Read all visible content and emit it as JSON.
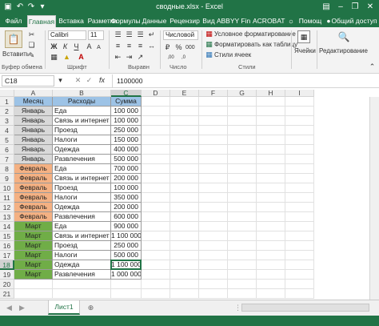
{
  "titlebar": {
    "title": "сводные.xlsx - Excel",
    "qa_icons": [
      "save-icon",
      "undo-icon",
      "redo-icon",
      "customize-icon"
    ],
    "window_controls": [
      "ribbon-display-icon",
      "minimize-icon",
      "restore-icon",
      "close-icon"
    ]
  },
  "tabs": [
    "Файл",
    "Главная",
    "Вставка",
    "Разметка",
    "Формулы",
    "Данные",
    "Рецензир",
    "Вид",
    "ABBYY Fin",
    "ACROBAT"
  ],
  "active_tab": "Главная",
  "tell_me": "Помощ",
  "share": "Общий доступ",
  "ribbon": {
    "paste_label": "Вставить",
    "font_name": "Calibri",
    "font_size": "11",
    "number_format": "Числовой",
    "cond_format": "Условное форматирование",
    "format_table": "Форматировать как таблицу",
    "cell_styles": "Стили ячеек",
    "cells_label": "Ячейки",
    "editing_label": "Редактирование",
    "groups": [
      "Буфер обмена",
      "Шрифт",
      "Выравн",
      "Число",
      "Стили"
    ]
  },
  "formula_bar": {
    "name_box": "C18",
    "fx": "fx",
    "value": "1100000"
  },
  "columns": [
    "A",
    "B",
    "C",
    "D",
    "E",
    "F",
    "G",
    "H",
    "I"
  ],
  "selected_column": "C",
  "selected_row": 18,
  "row_numbers": [
    1,
    2,
    3,
    4,
    5,
    6,
    7,
    8,
    9,
    10,
    11,
    12,
    13,
    14,
    15,
    16,
    17,
    18,
    19,
    20,
    21,
    22
  ],
  "table": {
    "headers": [
      "Месяц",
      "Расходы",
      "Сумма"
    ],
    "header_color": "#9dc3e6",
    "rows": [
      {
        "month": "Январь",
        "expense": "Еда",
        "sum": "100 000",
        "color": "#d9d9d9"
      },
      {
        "month": "Январь",
        "expense": "Связь и интернет",
        "sum": "100 000",
        "color": "#d9d9d9"
      },
      {
        "month": "Январь",
        "expense": "Проезд",
        "sum": "250 000",
        "color": "#d9d9d9"
      },
      {
        "month": "Январь",
        "expense": "Налоги",
        "sum": "150 000",
        "color": "#d9d9d9"
      },
      {
        "month": "Январь",
        "expense": "Одежда",
        "sum": "400 000",
        "color": "#d9d9d9"
      },
      {
        "month": "Январь",
        "expense": "Развлечения",
        "sum": "500 000",
        "color": "#d9d9d9"
      },
      {
        "month": "Февраль",
        "expense": "Еда",
        "sum": "700 000",
        "color": "#f4b183"
      },
      {
        "month": "Февраль",
        "expense": "Связь и интернет",
        "sum": "200 000",
        "color": "#f4b183"
      },
      {
        "month": "Февраль",
        "expense": "Проезд",
        "sum": "100 000",
        "color": "#f4b183"
      },
      {
        "month": "Февраль",
        "expense": "Налоги",
        "sum": "350 000",
        "color": "#f4b183"
      },
      {
        "month": "Февраль",
        "expense": "Одежда",
        "sum": "200 000",
        "color": "#f4b183"
      },
      {
        "month": "Февраль",
        "expense": "Развлечения",
        "sum": "600 000",
        "color": "#f4b183"
      },
      {
        "month": "Март",
        "expense": "Еда",
        "sum": "900 000",
        "color": "#70ad47"
      },
      {
        "month": "Март",
        "expense": "Связь и интернет",
        "sum": "1 100 000",
        "color": "#70ad47"
      },
      {
        "month": "Март",
        "expense": "Проезд",
        "sum": "250 000",
        "color": "#70ad47"
      },
      {
        "month": "Март",
        "expense": "Налоги",
        "sum": "500 000",
        "color": "#70ad47"
      },
      {
        "month": "Март",
        "expense": "Одежда",
        "sum": "1 100 000",
        "color": "#70ad47"
      },
      {
        "month": "Март",
        "expense": "Развлечения",
        "sum": "1 000 000",
        "color": "#70ad47"
      }
    ]
  },
  "sheet_tab": "Лист1",
  "colors": {
    "brand": "#217346"
  }
}
